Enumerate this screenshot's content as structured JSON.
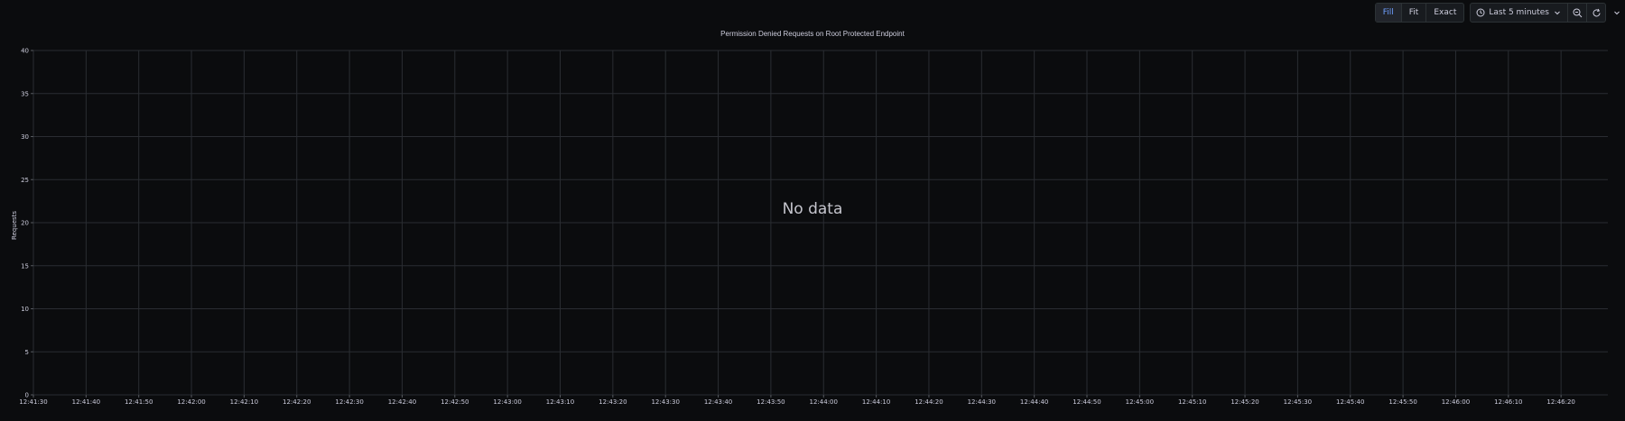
{
  "toolbar": {
    "fill_label": "Fill",
    "fit_label": "Fit",
    "exact_label": "Exact",
    "time_range_label": "Last 5 minutes"
  },
  "panel": {
    "title": "Permission Denied Requests on Root Protected Endpoint",
    "no_data_label": "No data",
    "ylabel": "Requests"
  },
  "chart_data": {
    "type": "line",
    "title": "Permission Denied Requests on Root Protected Endpoint",
    "xlabel": "",
    "ylabel": "Requests",
    "ylim": [
      0,
      40
    ],
    "yticks": [
      "0",
      "5",
      "10",
      "15",
      "20",
      "25",
      "30",
      "35",
      "40"
    ],
    "xticks": [
      "12:41:30",
      "12:41:40",
      "12:41:50",
      "12:42:00",
      "12:42:10",
      "12:42:20",
      "12:42:30",
      "12:42:40",
      "12:42:50",
      "12:43:00",
      "12:43:10",
      "12:43:20",
      "12:43:30",
      "12:43:40",
      "12:43:50",
      "12:44:00",
      "12:44:10",
      "12:44:20",
      "12:44:30",
      "12:44:40",
      "12:44:50",
      "12:45:00",
      "12:45:10",
      "12:45:20",
      "12:45:30",
      "12:45:40",
      "12:45:50",
      "12:46:00",
      "12:46:10",
      "12:46:20"
    ],
    "series": [],
    "grid": true
  }
}
